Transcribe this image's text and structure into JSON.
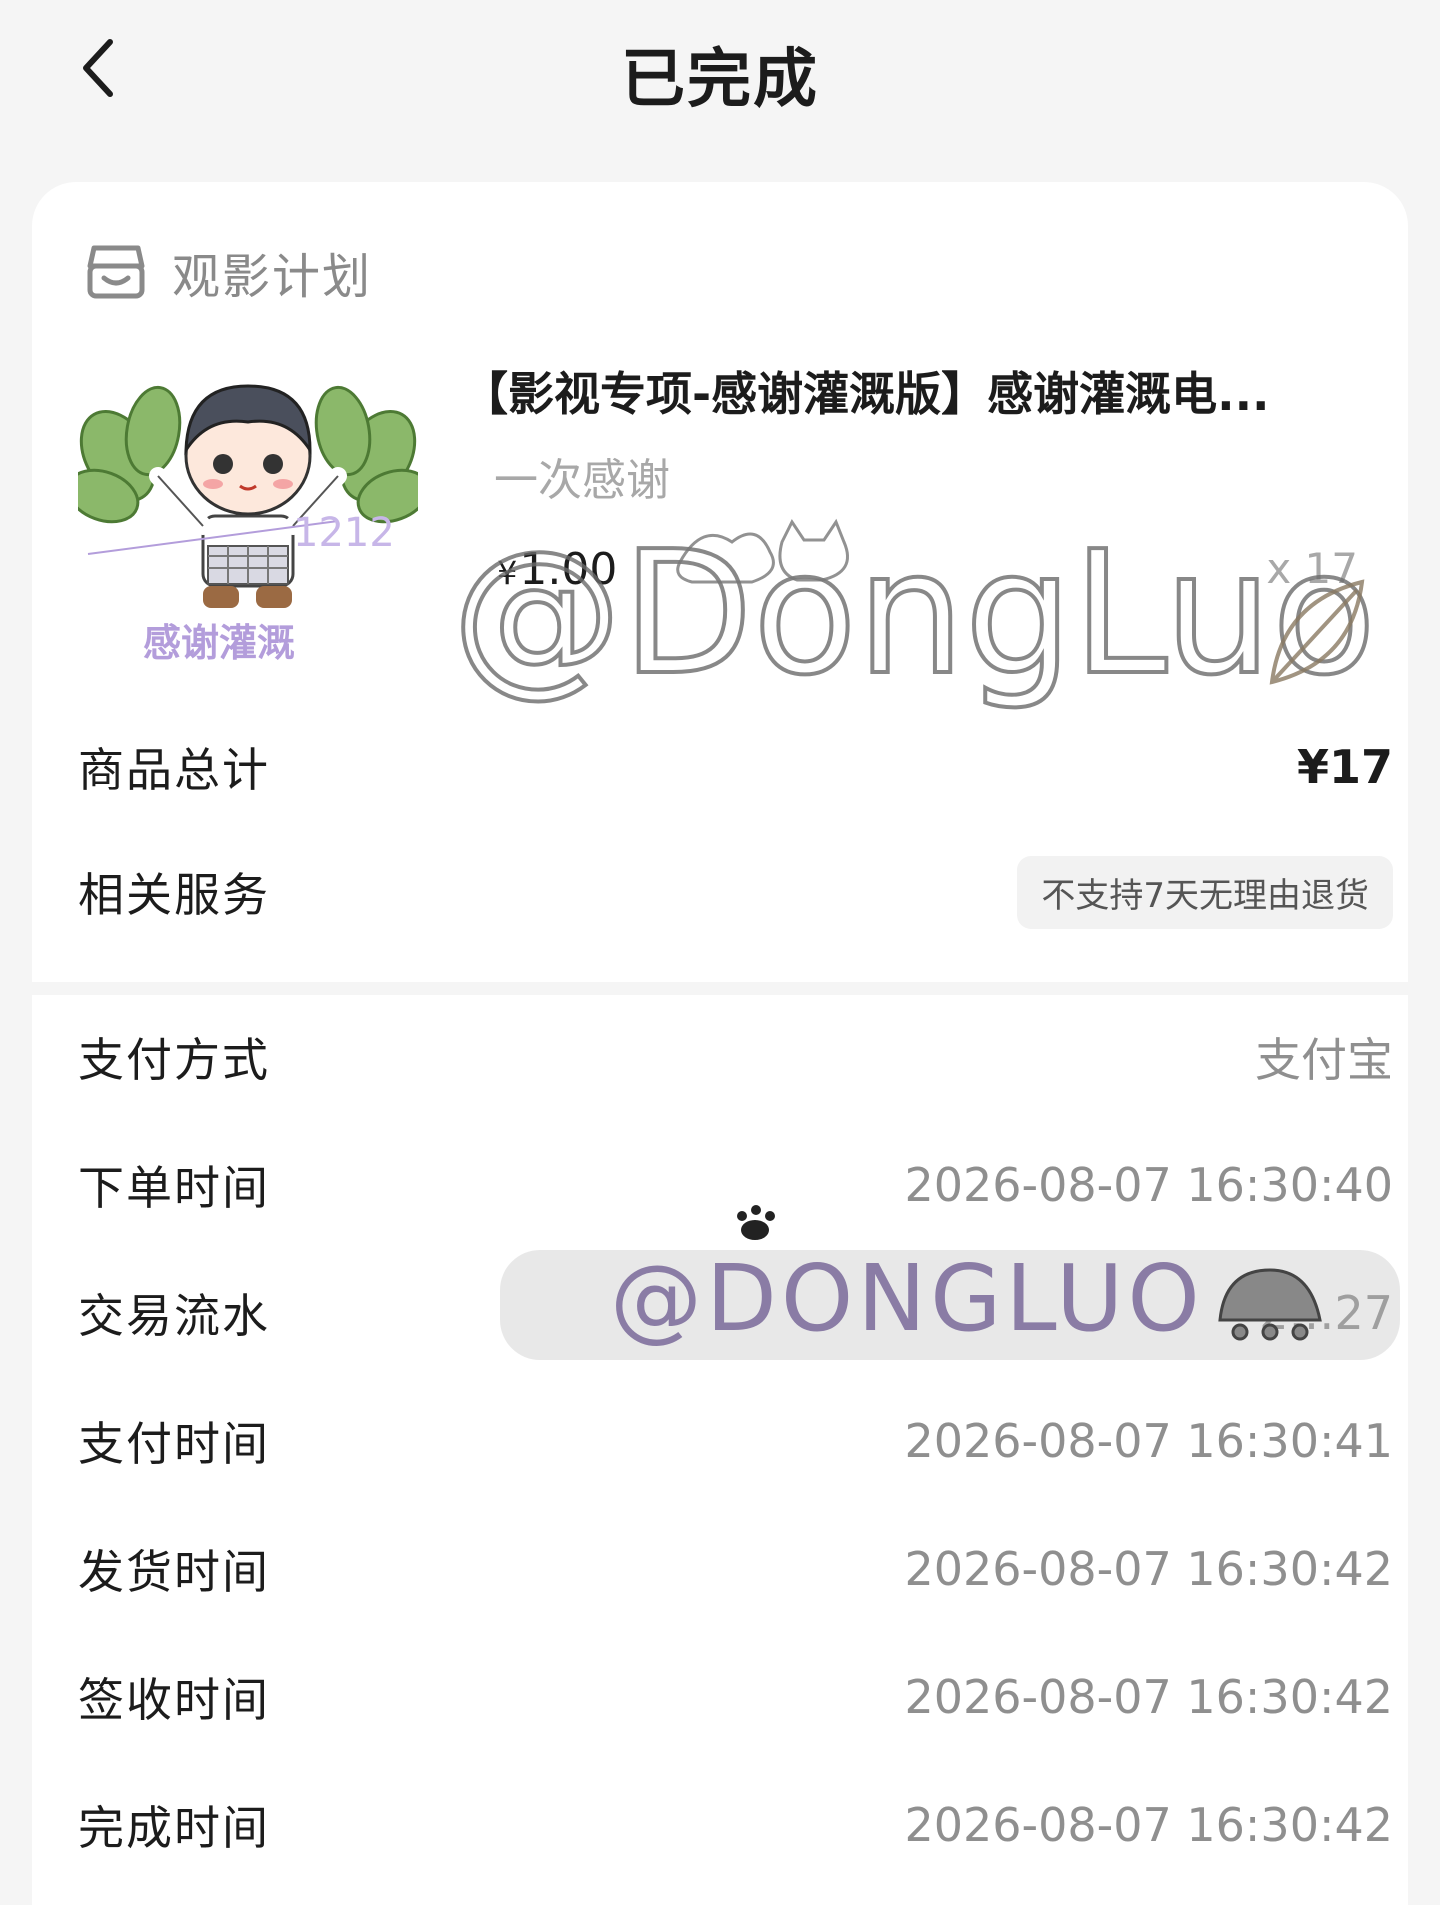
{
  "nav": {
    "title": "已完成"
  },
  "store": {
    "name": "观影计划"
  },
  "product": {
    "title": "【影视专项-感谢灌溉版】感谢灌溉电...",
    "spec": "一次感谢",
    "currency": "¥",
    "price": "1.00",
    "quantity": "x 17",
    "thumb_caption": "感谢灌溉",
    "thumb_scribble": "1212"
  },
  "watermarks": {
    "top": "@DongLuo",
    "bottom": "@DONGLUO"
  },
  "summary": {
    "total_label": "商品总计",
    "total_value": "¥17",
    "service_label": "相关服务",
    "service_badge": "不支持7天无理由退货"
  },
  "details": [
    {
      "label": "支付方式",
      "value": "支付宝"
    },
    {
      "label": "下单时间",
      "value": "2026-08-07 16:30:40"
    },
    {
      "label": "交易流水",
      "value": "2…27"
    },
    {
      "label": "支付时间",
      "value": "2026-08-07 16:30:41"
    },
    {
      "label": "发货时间",
      "value": "2026-08-07 16:30:42"
    },
    {
      "label": "签收时间",
      "value": "2026-08-07 16:30:42"
    },
    {
      "label": "完成时间",
      "value": "2026-08-07 16:30:42"
    }
  ],
  "icons": {
    "back": "chevron-left-icon",
    "store": "shop-icon"
  },
  "colors": {
    "background": "#f5f5f5",
    "card": "#ffffff",
    "muted_text": "#8f8f8f",
    "thumb_caption": "#b39ddb"
  }
}
